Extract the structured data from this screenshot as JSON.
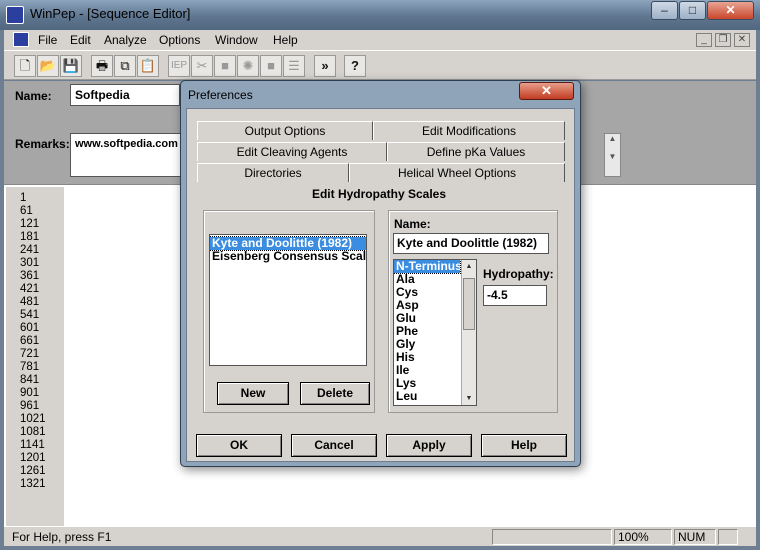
{
  "window": {
    "title": "WinPep - [Sequence Editor]",
    "controls": {
      "minimize": "–",
      "maximize": "□",
      "close": "✕"
    }
  },
  "menu": [
    "File",
    "Edit",
    "Analyze",
    "Options",
    "Window",
    "Help"
  ],
  "toolbar": {
    "items": [
      {
        "name": "new-doc-icon",
        "glyph": "🗋"
      },
      {
        "name": "open-folder-icon",
        "glyph": "📂"
      },
      {
        "name": "save-icon",
        "glyph": "💾"
      },
      {
        "name": "print-icon",
        "glyph": "🖶"
      },
      {
        "name": "copy-icon",
        "glyph": "⧉"
      },
      {
        "name": "paste-icon",
        "glyph": "📋"
      },
      {
        "name": "iep-label",
        "glyph": "IEP"
      },
      {
        "name": "cut-icon",
        "glyph": "✂"
      },
      {
        "name": "block-icon",
        "glyph": "■"
      },
      {
        "name": "settings-icon",
        "glyph": "✺"
      },
      {
        "name": "block2-icon",
        "glyph": "■"
      },
      {
        "name": "lines-icon",
        "glyph": "☰"
      },
      {
        "name": "forward-icon",
        "glyph": "»"
      },
      {
        "name": "help-icon",
        "glyph": "?"
      }
    ]
  },
  "form": {
    "name_label": "Name:",
    "name_value": "Softpedia",
    "remarks_label": "Remarks:",
    "remarks_value": "www.softpedia.com"
  },
  "line_numbers": [
    "1",
    "61",
    "121",
    "181",
    "241",
    "301",
    "361",
    "421",
    "481",
    "541",
    "601",
    "661",
    "721",
    "781",
    "841",
    "901",
    "961",
    "1021",
    "1081",
    "1141",
    "1201",
    "1261",
    "1321"
  ],
  "status": {
    "text": "For Help, press F1",
    "zoom": "100%",
    "num": "NUM"
  },
  "dialog": {
    "title": "Preferences",
    "close": "✕",
    "tabs_row1": [
      "Output Options",
      "Edit Modifications"
    ],
    "tabs_row2": [
      "Edit Cleaving Agents",
      "Define pKa Values"
    ],
    "tabs_row3": [
      "Directories",
      "Helical Wheel Options"
    ],
    "panel_title": "Edit Hydropathy Scales",
    "scales": [
      "Kyte and Doolittle (1982)",
      "Eisenberg Consensus Scale ("
    ],
    "selected_scale_index": 0,
    "new_button": "New",
    "delete_button": "Delete",
    "name_label": "Name:",
    "name_value": "Kyte and Doolittle (1982)",
    "residues": [
      "N-Terminus",
      "Ala",
      "Cys",
      "Asp",
      "Glu",
      "Phe",
      "Gly",
      "His",
      "Ile",
      "Lys",
      "Leu"
    ],
    "selected_residue_index": 0,
    "hydropathy_label": "Hydropathy:",
    "hydropathy_value": "-4.5",
    "ok_button": "OK",
    "cancel_button": "Cancel",
    "apply_button": "Apply",
    "help_button": "Help"
  }
}
